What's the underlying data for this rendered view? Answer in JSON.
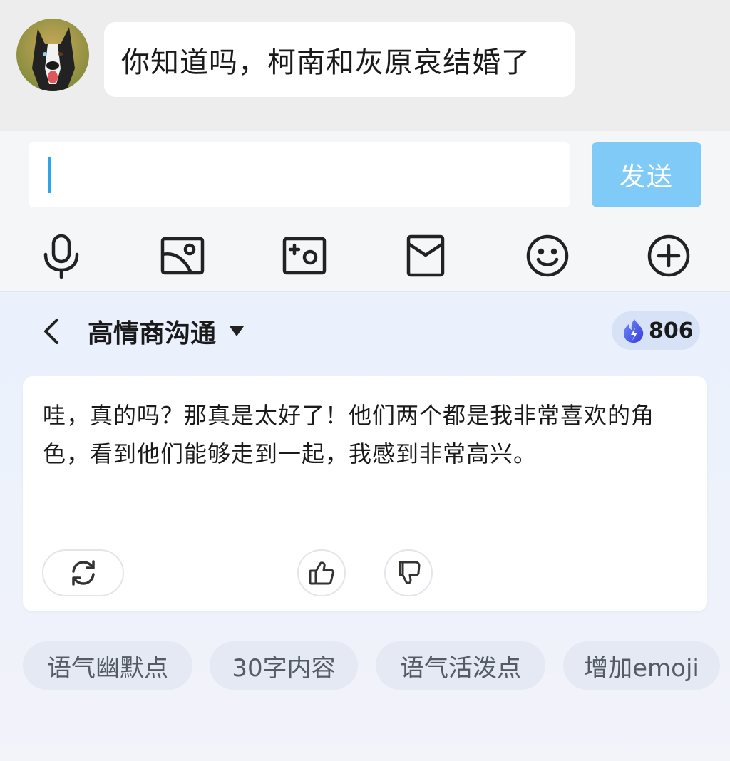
{
  "chat": {
    "message": "你知道吗，柯南和灰原哀结婚了"
  },
  "composer": {
    "input_value": "",
    "send_label": "发送",
    "send_color": "#7fcaf7"
  },
  "toolbar": {
    "icons": [
      "microphone-icon",
      "image-icon",
      "camera-icon",
      "red-packet-icon",
      "emoji-icon",
      "plus-icon"
    ]
  },
  "assistant": {
    "mode_label": "高情商沟通",
    "credits": "806",
    "reply_text": "哇，真的吗？那真是太好了！他们两个都是我非常喜欢的角色，看到他们能够走到一起，我感到非常高兴。",
    "suggestions": [
      "语气幽默点",
      "30字内容",
      "语气活泼点",
      "增加emoji"
    ]
  }
}
